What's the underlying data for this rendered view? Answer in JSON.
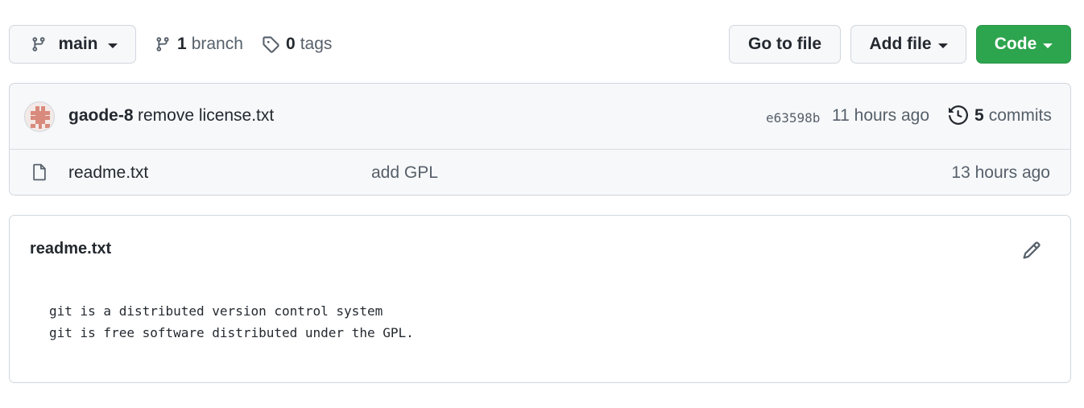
{
  "toolbar": {
    "branch_name": "main",
    "branches_count": "1",
    "branches_label": "branch",
    "tags_count": "0",
    "tags_label": "tags",
    "go_to_file": "Go to file",
    "add_file": "Add file",
    "code": "Code"
  },
  "latest_commit": {
    "author": "gaode-8",
    "message": "remove license.txt",
    "sha": "e63598b",
    "time": "11 hours ago",
    "commits_count": "5",
    "commits_label": "commits"
  },
  "files": [
    {
      "name": "readme.txt",
      "last_commit": "add GPL",
      "time": "13 hours ago",
      "icon": "file-icon"
    }
  ],
  "readme": {
    "title": "readme.txt",
    "lines": [
      "git is a distributed version control system",
      "git is free software distributed under the GPL."
    ]
  },
  "colors": {
    "primary_green": "#2da44e",
    "border": "#d0d7de",
    "muted_text": "#57606a",
    "text": "#24292f",
    "subtle_bg": "#f6f8fa",
    "avatar_pattern": "#d88a7d"
  },
  "icons": [
    "git-branch-icon",
    "tag-icon",
    "caret-down-icon",
    "history-icon",
    "file-icon",
    "pencil-icon",
    "identicon-avatar"
  ]
}
